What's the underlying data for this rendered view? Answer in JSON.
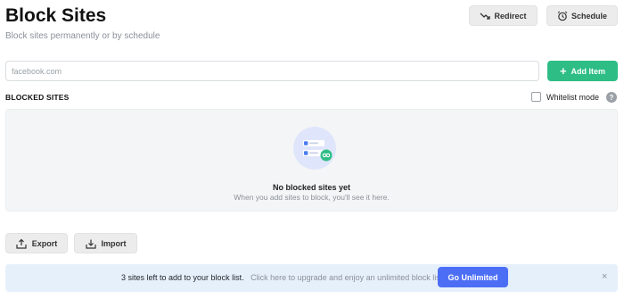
{
  "header": {
    "title": "Block Sites",
    "subtitle": "Block sites permanently or by schedule",
    "redirect_label": "Redirect",
    "schedule_label": "Schedule"
  },
  "add_form": {
    "input_placeholder": "facebook.com",
    "input_value": "",
    "add_label": "Add Item"
  },
  "blocked_list": {
    "section_label": "BLOCKED SITES",
    "whitelist_label": "Whitelist mode",
    "whitelist_checked": false,
    "help_glyph": "?",
    "empty_title": "No blocked sites yet",
    "empty_subtitle": "When you add sites to block, you'll see it here."
  },
  "actions": {
    "export_label": "Export",
    "import_label": "Import"
  },
  "upgrade_banner": {
    "strong_text": "3 sites left to add to your block list.",
    "muted_text": "Click here to upgrade and enjoy an unlimited block list.",
    "button_label": "Go Unlimited",
    "close_glyph": "×"
  },
  "colors": {
    "accent_green": "#2ebd85",
    "accent_blue": "#4c6ef5",
    "banner_bg": "#e6f0fb"
  },
  "icons": {
    "redirect": "redirect-arrow-icon",
    "schedule": "alarm-clock-icon",
    "add": "plus-icon",
    "export": "upload-icon",
    "import": "download-icon",
    "help": "question-circle-icon",
    "close": "close-icon"
  }
}
